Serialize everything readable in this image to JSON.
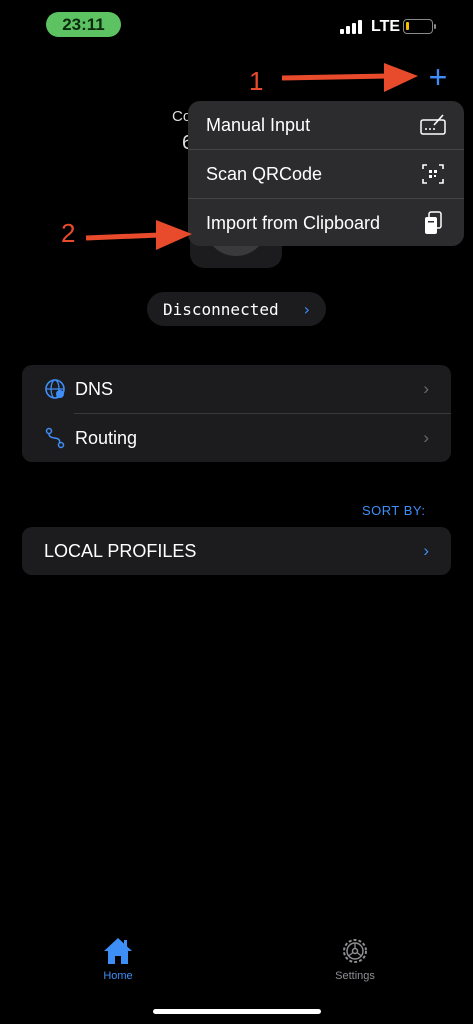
{
  "status_bar": {
    "time": "23:11",
    "network": "LTE",
    "battery_level": 0.12
  },
  "header": {
    "add_icon": "plus-icon",
    "add_label": "+"
  },
  "connection": {
    "status": "Disconnected"
  },
  "context_menu": {
    "items": [
      {
        "label": "Manual Input",
        "icon": "keyboard-pen-icon"
      },
      {
        "label": "Scan QRCode",
        "icon": "qrcode-scan-icon"
      },
      {
        "label": "Import from Clipboard",
        "icon": "clipboard-icon"
      }
    ]
  },
  "settings_group": {
    "items": [
      {
        "label": "DNS",
        "icon": "globe-icon"
      },
      {
        "label": "Routing",
        "icon": "route-icon"
      }
    ]
  },
  "profiles": {
    "sort_label": "SORT BY:",
    "section_label": "LOCAL PROFILES"
  },
  "tabbar": {
    "items": [
      {
        "label": "Home",
        "icon": "house-icon",
        "active": true
      },
      {
        "label": "Settings",
        "icon": "gear-icon",
        "active": false
      }
    ]
  },
  "annotations": [
    {
      "label": "1"
    },
    {
      "label": "2"
    }
  ],
  "colors": {
    "accent": "#3e8ef7",
    "annotation": "#e84a2c",
    "card": "#1c1c1e",
    "menu": "#2c2c2e"
  }
}
